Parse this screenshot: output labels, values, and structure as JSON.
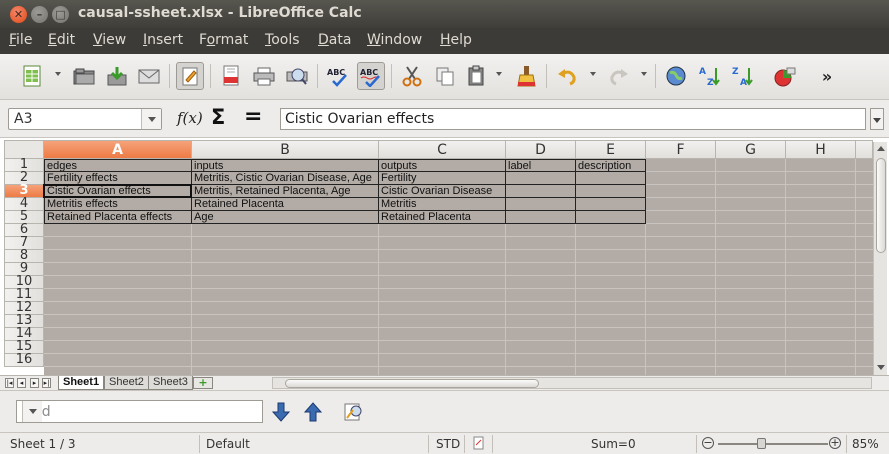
{
  "window": {
    "title": "causal-ssheet.xlsx - LibreOffice Calc",
    "close_glyph": "✕",
    "minimize_glyph": "–",
    "maximize_glyph": "□"
  },
  "menu": {
    "items": [
      {
        "key": "F",
        "rest": "ile"
      },
      {
        "key": "E",
        "rest": "dit"
      },
      {
        "key": "V",
        "rest": "iew"
      },
      {
        "key": "I",
        "rest": "nsert"
      },
      {
        "key": "",
        "pre": "F",
        "keymid": "o",
        "rest": "rmat"
      },
      {
        "key": "T",
        "rest": "ools"
      },
      {
        "key": "D",
        "rest": "ata"
      },
      {
        "key": "W",
        "rest": "indow"
      },
      {
        "key": "H",
        "rest": "elp"
      }
    ]
  },
  "toolbar": {
    "icons": [
      "new-spreadsheet-icon",
      "open-folder-icon",
      "save-icon",
      "email-icon",
      "edit-mode-icon",
      "export-pdf-icon",
      "print-icon",
      "print-preview-icon",
      "spellcheck-icon",
      "autospellcheck-icon",
      "cut-icon",
      "copy-icon",
      "paste-icon",
      "clone-formatting-icon",
      "undo-icon",
      "redo-icon",
      "navigator-icon",
      "sort-ascending-icon",
      "sort-descending-icon",
      "chart-icon"
    ],
    "overflow": "»",
    "labels": {
      "spell": "ABC",
      "az1": "A",
      "az2": "Z"
    }
  },
  "formula_bar": {
    "name_box": "A3",
    "fx_label": "f(x)",
    "sum_symbol": "Σ",
    "equals_symbol": "=",
    "content": "Cistic Ovarian effects"
  },
  "grid": {
    "columns": [
      "A",
      "B",
      "C",
      "D",
      "E",
      "F",
      "G",
      "H"
    ],
    "selected_column": "A",
    "rows": [
      "1",
      "2",
      "3",
      "4",
      "5",
      "6",
      "7",
      "8",
      "9",
      "10",
      "11",
      "12",
      "13",
      "14",
      "15",
      "16"
    ],
    "selected_row": "3",
    "cells": [
      [
        "edges",
        "inputs",
        "outputs",
        "label",
        "description"
      ],
      [
        "Fertility effects",
        "Metritis, Cistic Ovarian Disease, Age",
        "Fertility",
        "",
        ""
      ],
      [
        "Cistic Ovarian effects",
        "Metritis, Retained Placenta, Age",
        "Cistic Ovarian Disease",
        "",
        ""
      ],
      [
        "Metritis effects",
        "Retained Placenta",
        "Metritis",
        "",
        ""
      ],
      [
        "Retained Placenta effects",
        "Age",
        "Retained Placenta",
        "",
        ""
      ]
    ]
  },
  "sheets": {
    "tabs": [
      "Sheet1",
      "Sheet2",
      "Sheet3"
    ],
    "active": "Sheet1",
    "add_label": "+",
    "nav": [
      "|◂",
      "◂",
      "▸",
      "▸|"
    ]
  },
  "find": {
    "placeholder": "Find"
  },
  "status": {
    "sheet": "Sheet 1 / 3",
    "style": "Default",
    "mode": "STD",
    "sum": "Sum=0",
    "zoom": "85%",
    "zoom_minus": "−",
    "zoom_plus": "+"
  }
}
